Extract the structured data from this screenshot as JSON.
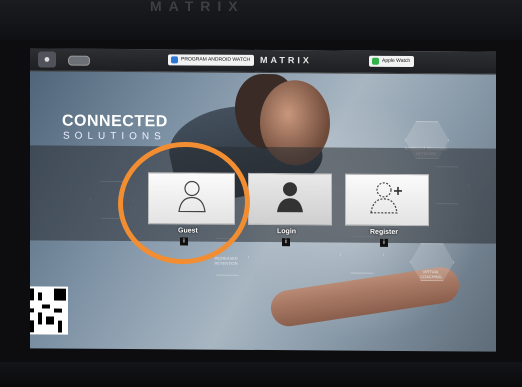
{
  "bezel": {
    "brand": "MATRIX"
  },
  "topbar": {
    "brand": "MATRIX",
    "badge_left": "PROGRAM ANDROID WATCH",
    "badge_right": "Apple Watch"
  },
  "hero": {
    "title": "CONNECTED",
    "subtitle": "SOLUTIONS"
  },
  "options": [
    {
      "label": "Guest",
      "info": "i"
    },
    {
      "label": "Login",
      "info": "i"
    },
    {
      "label": "Register",
      "info": "i"
    }
  ],
  "hex_labels": {
    "workout_tracking": "WORKOUT TRACKING NETWORK",
    "virtual_coaching": "VIRTUAL COACHING",
    "increased_retention": "INCREASED RETENTION"
  },
  "colors": {
    "highlight_ring": "#f28e31",
    "topbar": "#1d1f22"
  }
}
